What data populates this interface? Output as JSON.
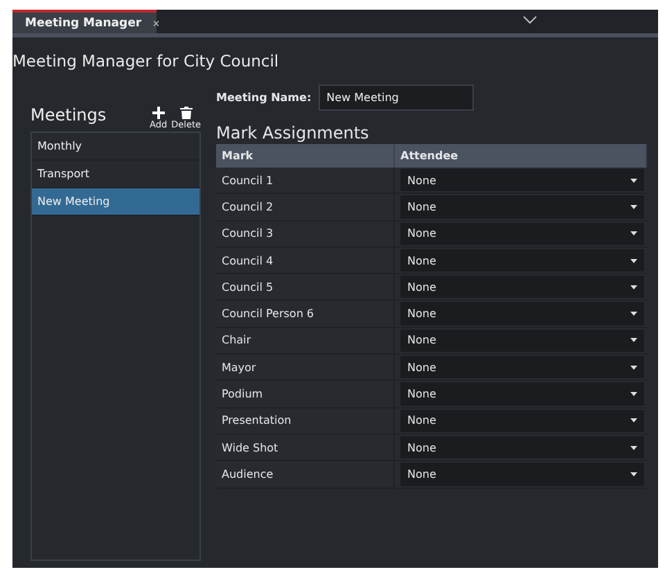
{
  "tab": {
    "title": "Meeting Manager",
    "close": "×",
    "selected": true
  },
  "heading": "Meeting Manager for City Council",
  "meetings": {
    "title": "Meetings",
    "add_label": "Add",
    "delete_label": "Delete",
    "items": [
      {
        "label": "Monthly",
        "selected": false
      },
      {
        "label": "Transport",
        "selected": false
      },
      {
        "label": "New Meeting",
        "selected": true
      }
    ]
  },
  "meeting_name": {
    "label": "Meeting Name:",
    "value": "New Meeting"
  },
  "assignments": {
    "title": "Mark Assignments",
    "columns": [
      "Mark",
      "Attendee"
    ],
    "rows": [
      {
        "mark": "Council 1",
        "attendee": "None"
      },
      {
        "mark": "Council 2",
        "attendee": "None"
      },
      {
        "mark": "Council 3",
        "attendee": "None"
      },
      {
        "mark": "Council 4",
        "attendee": "None"
      },
      {
        "mark": "Council 5",
        "attendee": "None"
      },
      {
        "mark": "Council Person 6",
        "attendee": "None"
      },
      {
        "mark": "Chair",
        "attendee": "None"
      },
      {
        "mark": "Mayor",
        "attendee": "None"
      },
      {
        "mark": "Podium",
        "attendee": "None"
      },
      {
        "mark": "Presentation",
        "attendee": "None"
      },
      {
        "mark": "Wide Shot",
        "attendee": "None"
      },
      {
        "mark": "Audience",
        "attendee": "None"
      }
    ]
  }
}
